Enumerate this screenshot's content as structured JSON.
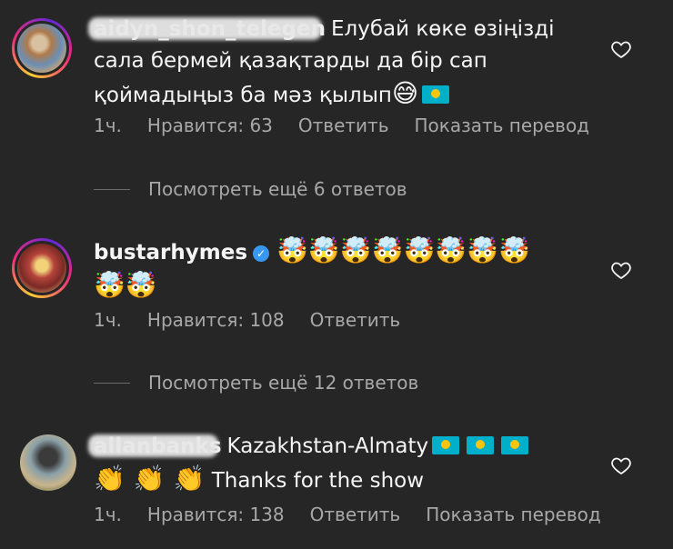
{
  "comments": [
    {
      "username": "aidyn_shon_telegen",
      "text_line1": "Елубай көке өзіңізді",
      "text_line2": "сала бермей қазақтарды да бір сап",
      "text_line3": "қоймадыңыз ба мәз қылып",
      "emoji_1": "😅",
      "time": "1ч.",
      "likes": "Нравится: 63",
      "reply": "Ответить",
      "translate": "Показать перевод"
    },
    {
      "username": "bustarhymes",
      "emojis": "🤯🤯🤯🤯🤯🤯🤯🤯",
      "emojis_line2": "🤯🤯",
      "time": "1ч.",
      "likes": "Нравится: 108",
      "reply": "Ответить"
    },
    {
      "username": "allanbanks",
      "text_line1": "Kazakhstan-Almaty",
      "emojis_line2": "👏 👏 👏",
      "text_line2": "Thanks for the show",
      "time": "1ч.",
      "likes": "Нравится: 138",
      "reply": "Ответить",
      "translate": "Показать перевод"
    }
  ],
  "view_more_1": "Посмотреть ещё 6 ответов",
  "view_more_2": "Посмотреть ещё 12 ответов",
  "colors": {
    "background": "#262626",
    "text": "#f5f5f5",
    "meta": "#a8a8a8",
    "verified": "#3897f0"
  }
}
